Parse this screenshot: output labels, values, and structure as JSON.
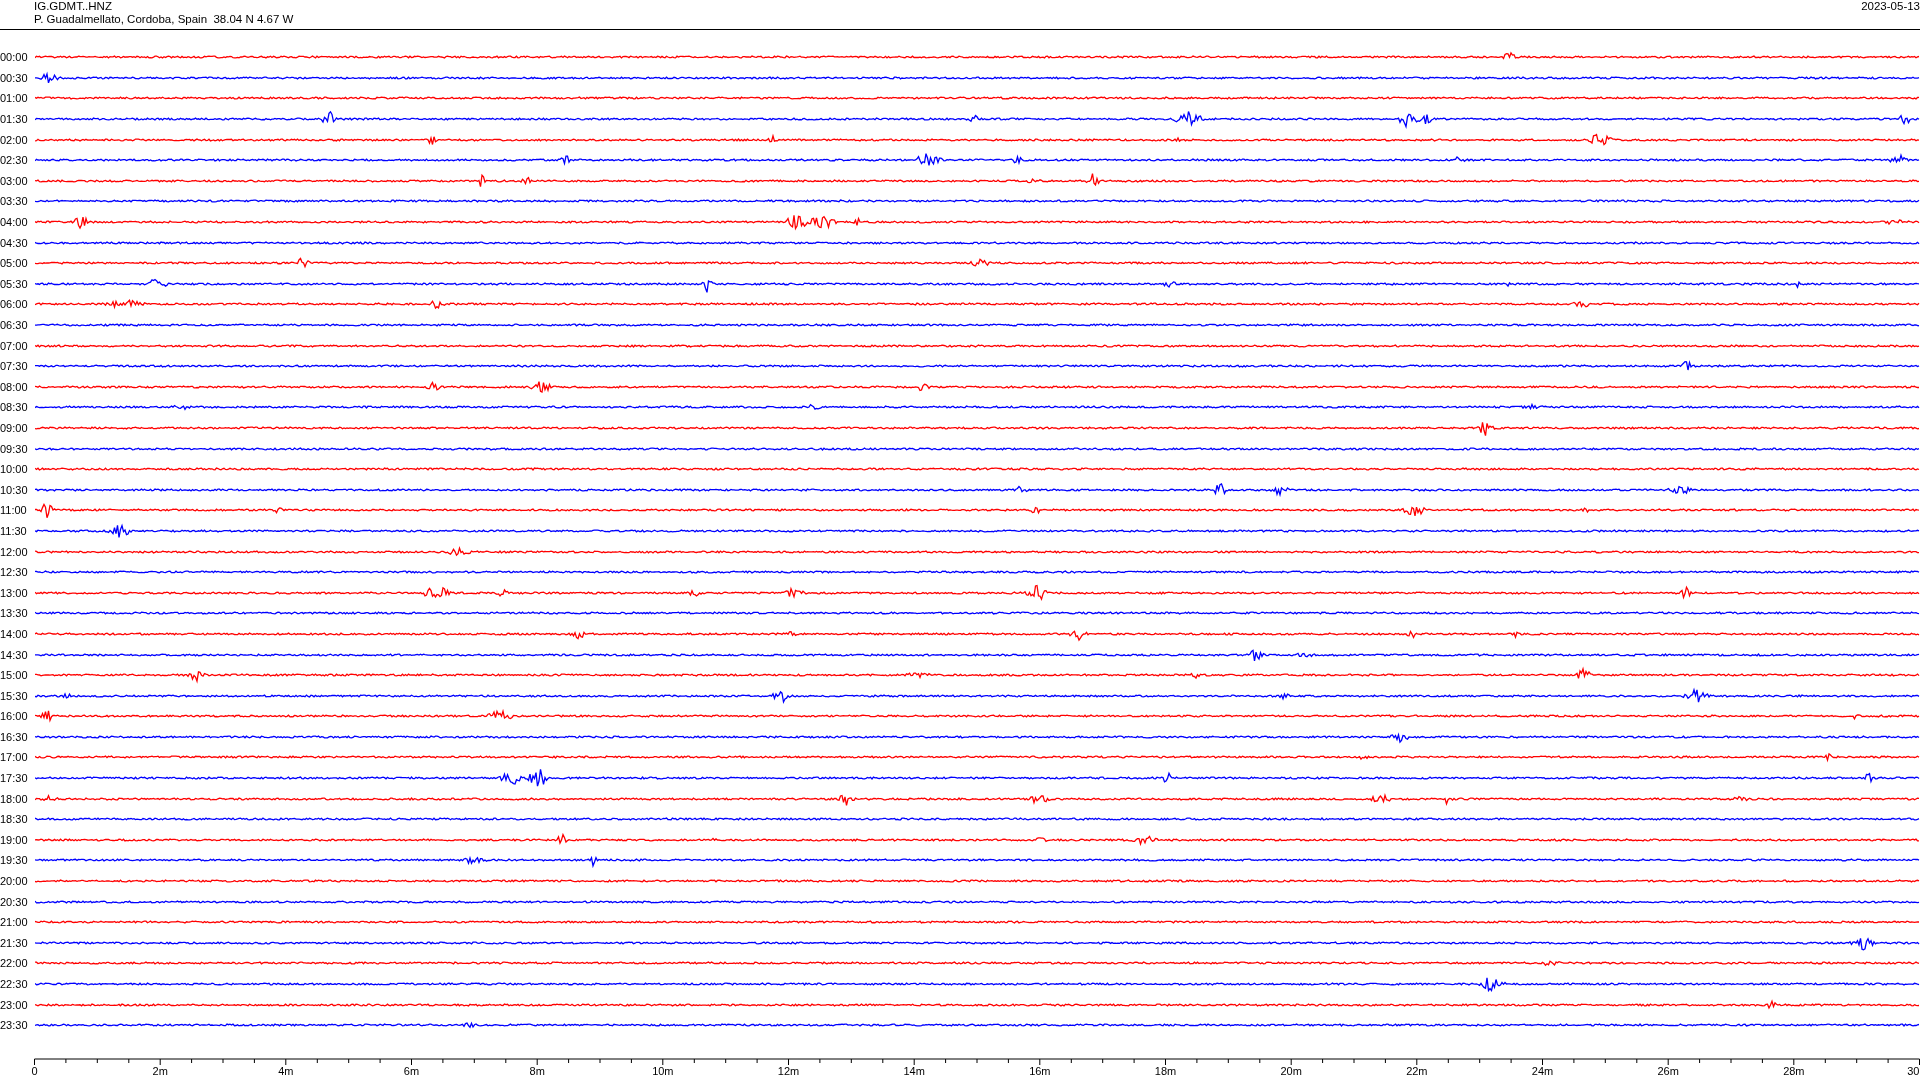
{
  "header": {
    "station": "IG.GDMT..HNZ",
    "location": "P. Guadalmellato, Cordoba, Spain  38.04 N 4.67 W",
    "date": "2023-05-13"
  },
  "rows": [
    {
      "label": "00:00",
      "color": "#ff0000"
    },
    {
      "label": "00:30",
      "color": "#0000ff"
    },
    {
      "label": "01:00",
      "color": "#ff0000"
    },
    {
      "label": "01:30",
      "color": "#0000ff"
    },
    {
      "label": "02:00",
      "color": "#ff0000"
    },
    {
      "label": "02:30",
      "color": "#0000ff"
    },
    {
      "label": "03:00",
      "color": "#ff0000"
    },
    {
      "label": "03:30",
      "color": "#0000ff"
    },
    {
      "label": "04:00",
      "color": "#ff0000"
    },
    {
      "label": "04:30",
      "color": "#0000ff"
    },
    {
      "label": "05:00",
      "color": "#ff0000"
    },
    {
      "label": "05:30",
      "color": "#0000ff"
    },
    {
      "label": "06:00",
      "color": "#ff0000"
    },
    {
      "label": "06:30",
      "color": "#0000ff"
    },
    {
      "label": "07:00",
      "color": "#ff0000"
    },
    {
      "label": "07:30",
      "color": "#0000ff"
    },
    {
      "label": "08:00",
      "color": "#ff0000"
    },
    {
      "label": "08:30",
      "color": "#0000ff"
    },
    {
      "label": "09:00",
      "color": "#ff0000"
    },
    {
      "label": "09:30",
      "color": "#0000ff"
    },
    {
      "label": "10:00",
      "color": "#ff0000"
    },
    {
      "label": "10:30",
      "color": "#0000ff"
    },
    {
      "label": "11:00",
      "color": "#ff0000"
    },
    {
      "label": "11:30",
      "color": "#0000ff"
    },
    {
      "label": "12:00",
      "color": "#ff0000"
    },
    {
      "label": "12:30",
      "color": "#0000ff"
    },
    {
      "label": "13:00",
      "color": "#ff0000"
    },
    {
      "label": "13:30",
      "color": "#0000ff"
    },
    {
      "label": "14:00",
      "color": "#ff0000"
    },
    {
      "label": "14:30",
      "color": "#0000ff"
    },
    {
      "label": "15:00",
      "color": "#ff0000"
    },
    {
      "label": "15:30",
      "color": "#0000ff"
    },
    {
      "label": "16:00",
      "color": "#ff0000"
    },
    {
      "label": "16:30",
      "color": "#0000ff"
    },
    {
      "label": "17:00",
      "color": "#ff0000"
    },
    {
      "label": "17:30",
      "color": "#0000ff"
    },
    {
      "label": "18:00",
      "color": "#ff0000"
    },
    {
      "label": "18:30",
      "color": "#0000ff"
    },
    {
      "label": "19:00",
      "color": "#ff0000"
    },
    {
      "label": "19:30",
      "color": "#0000ff"
    },
    {
      "label": "20:00",
      "color": "#ff0000"
    },
    {
      "label": "20:30",
      "color": "#0000ff"
    },
    {
      "label": "21:00",
      "color": "#ff0000"
    },
    {
      "label": "21:30",
      "color": "#0000ff"
    },
    {
      "label": "22:00",
      "color": "#ff0000"
    },
    {
      "label": "22:30",
      "color": "#0000ff"
    },
    {
      "label": "23:00",
      "color": "#ff0000"
    },
    {
      "label": "23:30",
      "color": "#0000ff"
    }
  ],
  "axis": {
    "ticks": [
      "0",
      "2m",
      "4m",
      "6m",
      "8m",
      "10m",
      "12m",
      "14m",
      "16m",
      "18m",
      "20m",
      "22m",
      "24m",
      "26m",
      "28m",
      "30"
    ]
  }
}
